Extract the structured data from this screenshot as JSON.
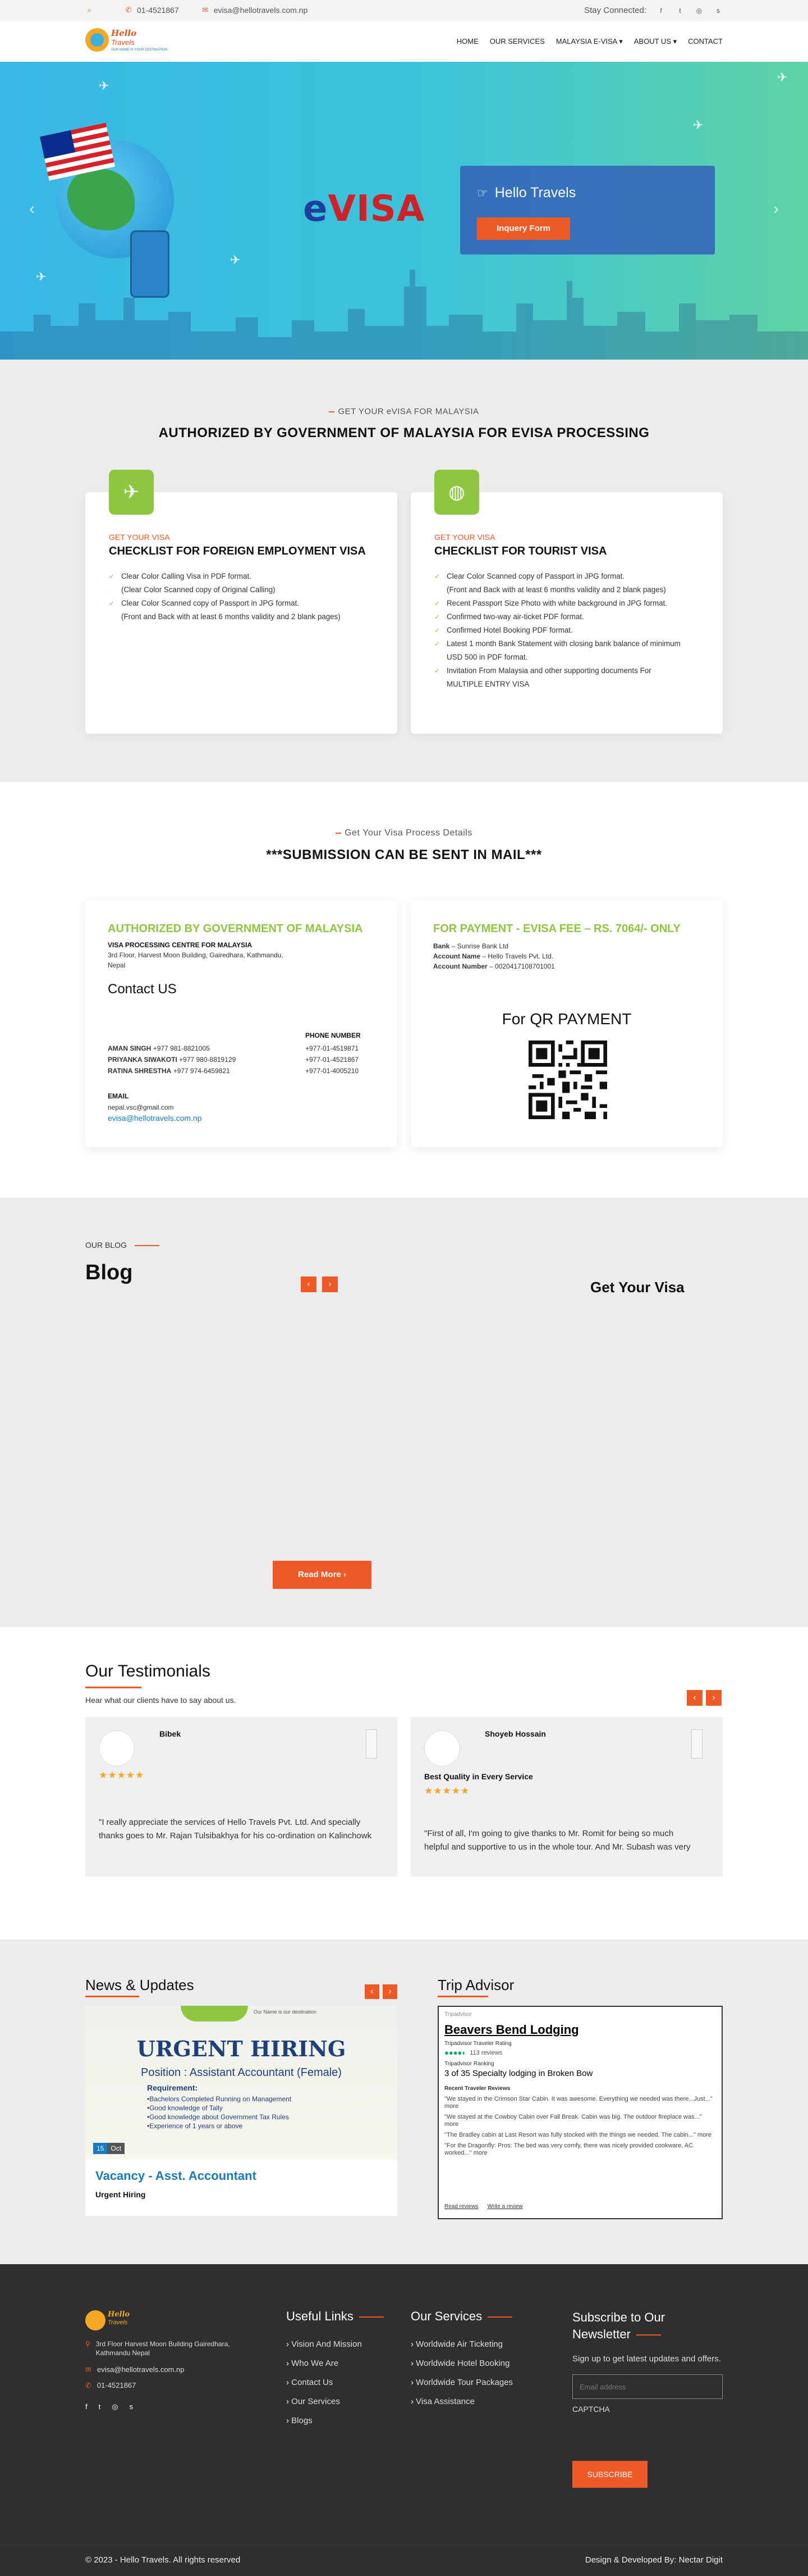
{
  "topbar": {
    "phone": "01-4521867",
    "email": "evisa@hellotravels.com.np",
    "stay_connected": "Stay Connected:",
    "socials": [
      "facebook-icon",
      "twitter-icon",
      "instagram-icon",
      "skype-icon"
    ]
  },
  "logo": {
    "line1": "Hello",
    "line2": "Travels",
    "tagline": "OUR NAME IS YOUR DESTINATION"
  },
  "nav": {
    "items": [
      "HOME",
      "OUR SERVICES",
      "MALAYSIA E-VISA ▾",
      "ABOUT US ▾",
      "CONTACT"
    ]
  },
  "hero": {
    "evisa_e": "e",
    "evisa_rest": "VISA",
    "card_title": "Hello Travels",
    "button": "Inquery Form"
  },
  "authorized": {
    "kicker": "GET YOUR eVISA FOR MALAYSIA",
    "title": "AUTHORIZED BY GOVERNMENT OF MALAYSIA FOR EVISA PROCESSING",
    "cards": [
      {
        "sub": "GET YOUR VISA",
        "title": "CHECKLIST FOR FOREIGN EMPLOYMENT VISA",
        "items": [
          {
            "a": "Clear Color Calling Visa in PDF format.",
            "b": "(Clear Color Scanned copy of Original Calling)"
          },
          {
            "a": "Clear Color Scanned copy of Passport in JPG format.",
            "b": "(Front and Back with at least 6 months validity and 2 blank pages)"
          }
        ]
      },
      {
        "sub": "GET YOUR VISA",
        "title": "CHECKLIST FOR TOURIST VISA",
        "items": [
          {
            "a": "Clear Color Scanned copy of Passport in JPG format.",
            "b": "(Front and Back with at least 6 months validity and 2 blank pages)"
          },
          {
            "a": "Recent Passport Size Photo with white background in JPG format.",
            "b": ""
          },
          {
            "a": "Confirmed two-way air-ticket PDF format.",
            "b": ""
          },
          {
            "a": "Confirmed Hotel Booking PDF format.",
            "b": ""
          },
          {
            "a": "Latest 1 month Bank Statement with closing bank balance of minimum",
            "b": "USD 500 in PDF format."
          },
          {
            "a": "Invitation From Malaysia and other supporting documents For",
            "b": "MULTIPLE ENTRY VISA"
          }
        ]
      }
    ]
  },
  "process": {
    "kicker": "Get Your Visa Process Details",
    "title": "***SUBMISSION CAN BE SENT IN MAIL***",
    "left": {
      "heading": "AUTHORIZED BY GOVERNMENT OF MALAYSIA",
      "centre": "VISA PROCESSING CENTRE FOR MALAYSIA",
      "address1": "3rd Floor, Harvest Moon Building, Gairedhara, Kathmandu,",
      "address2": "Nepal",
      "contact_title": "Contact US",
      "phone_header": "PHONE NUMBER",
      "people": [
        {
          "name": "AMAN SINGH",
          "mobile": "+977 981-8821005",
          "phone": "+977-01-4519871"
        },
        {
          "name": "PRIYANKA SIWAKOTI",
          "mobile": "+977 980-8819129",
          "phone": "+977-01-4521867"
        },
        {
          "name": "RATINA SHRESTHA",
          "mobile": "+977 974-6459821",
          "phone": "+977-01-4005210"
        }
      ],
      "email_label": "EMAIL",
      "email1": "nepal.vsc@gmail.com",
      "email2": "evisa@hellotravels.com.np"
    },
    "right": {
      "heading": "FOR PAYMENT - EVISA FEE – RS. 7064/- ONLY",
      "bank_label": "Bank",
      "bank": " – Sunrise Bank Ltd",
      "acc_name_label": "Account Name",
      "acc_name": " – Hello Travels Pvt. Ltd.",
      "acc_no_label": "Account Number",
      "acc_no": " – 0020417108701001",
      "qr_title": "For QR PAYMENT"
    }
  },
  "blog": {
    "kicker": "OUR BLOG",
    "title": "Blog",
    "side_title": "Get Your Visa",
    "read_more": "Read More ›"
  },
  "testimonials": {
    "title": "Our Testimonials",
    "sub": "Hear what our clients have to say about us.",
    "items": [
      {
        "name": "Bibek",
        "headline": "",
        "stars": "★★★★★",
        "text1": "\"I really appreciate the services of Hello Travels Pvt. Ltd. And specially",
        "text2": "thanks goes to Mr. Rajan Tulsibakhya for his co-ordination on Kalinchowk"
      },
      {
        "name": "Shoyeb Hossain",
        "headline": "Best Quality in Every Service",
        "stars": "★★★★★",
        "text1": "\"First of all, I'm going to give thanks to Mr. Romit for being so much",
        "text2": "helpful and supportive to us in the whole tour. And Mr. Subash was very"
      }
    ]
  },
  "news": {
    "title": "News & Updates",
    "banner_top": "Our Name is our destination",
    "banner_title": "URGENT HIRING",
    "banner_position": "Position : Assistant Accountant (Female)",
    "req_title": "Requirement:",
    "requirements": [
      "Bachelors Completed Running on Management",
      "Good knowledge of Tally",
      "Good knowledge about Government Tax Rules",
      "Experience of 1 years or above"
    ],
    "date_day": "15",
    "date_month": "Oct",
    "post_title": "Vacancy - Asst. Accountant",
    "post_sub": "Urgent Hiring"
  },
  "trip": {
    "title": "Trip Advisor",
    "logo_alt": "Tripadvisor",
    "name": "Beavers Bend Lodging",
    "rating_label": "Tripadvisor Traveler Rating",
    "reviews": "113 reviews",
    "ranking_label": "Tripadvisor Ranking",
    "ranking": "3 of 35 Specialty lodging in Broken Bow",
    "recent": "Recent Traveler Reviews",
    "quotes": [
      "\"We stayed in the Crimson Star Cabin. It was awesome. Everything we needed was there...Just...\" more",
      "\"We stayed at the Cowboy Cabin over Fall Break. Cabin was big. The outdoor fireplace was...\" more",
      "\"The Bradley cabin at Last Resort was fully stocked with the things we needed. The cabin...\" more",
      "\"For the Dragonfly: Pros: The bed was very comfy, there was nicely provided cookware, AC worked...\" more"
    ],
    "read_reviews": "Read reviews",
    "write_review": "Write a review"
  },
  "footer": {
    "address1": "3rd Floor Harvest Moon Building Gairedhara,",
    "address2": "Kathmandu Nepal",
    "email": "evisa@hellotravels.com.np",
    "phone": "01-4521867",
    "useful_title": "Useful Links",
    "useful": [
      "Vision And Mission",
      "Who We Are",
      "Contact Us",
      "Our Services",
      "Blogs"
    ],
    "services_title": "Our Services",
    "services": [
      "Worldwide Air Ticketing",
      "Worldwide Hotel Booking",
      "Worldwide Tour Packages",
      "Visa Assistance"
    ],
    "subscribe_title": "Subscribe to Our Newsletter",
    "subscribe_text": "Sign up to get latest updates and offers.",
    "email_placeholder": "Email address",
    "captcha": "CAPTCHA",
    "subscribe_btn": "SUBSCRIBE",
    "copyright": "© 2023 - Hello Travels. All rights reserved",
    "credit": "Design & Developed By: Nectar Digit"
  },
  "colors": {
    "accent": "#ee5a25",
    "green": "#8dc63f",
    "blue": "#1a7abf",
    "footer": "#2f2f2f"
  }
}
